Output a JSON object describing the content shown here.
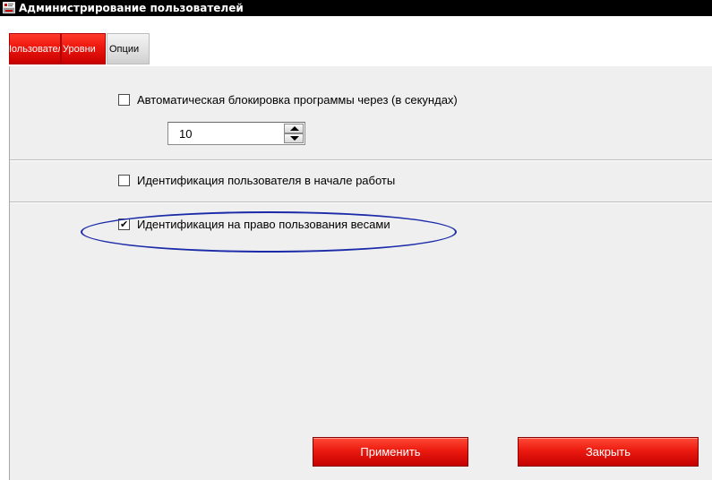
{
  "window": {
    "title": "Администрирование пользователей",
    "app_icon": "scale-app-icon"
  },
  "tabs": [
    {
      "label": "Пользователи",
      "active": false,
      "color": "#e8140c"
    },
    {
      "label": "Уровни",
      "active": false,
      "color": "#e8140c"
    },
    {
      "label": "Опции",
      "active": true,
      "color": "#dcdcdc"
    }
  ],
  "options": {
    "auto_lock": {
      "label": "Автоматическая блокировка программы через (в секундах)",
      "checked": false
    },
    "auto_lock_seconds": "10",
    "user_identification_start": {
      "label": "Идентификация пользователя в начале работы",
      "checked": false
    },
    "scale_use_identification": {
      "label": "Идентификация на право пользования весами",
      "checked": true
    }
  },
  "buttons": {
    "apply": "Применить",
    "close": "Закрыть"
  },
  "colors": {
    "accent_red": "#e8140c",
    "highlight_ellipse": "#1a2aa8",
    "panel_bg": "#efefef"
  }
}
